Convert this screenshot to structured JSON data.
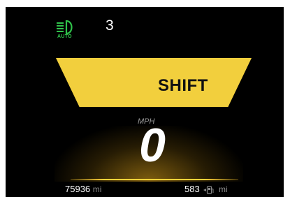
{
  "header": {
    "headlight_mode": "AUTO",
    "gear": "3"
  },
  "alert": {
    "label": "SHIFT"
  },
  "speed": {
    "unit": "MPH",
    "value": "0"
  },
  "footer": {
    "odometer_value": "75936",
    "odometer_unit": "mi",
    "range_value": "583",
    "range_unit": "mi"
  },
  "colors": {
    "headlight_green": "#2fc24a",
    "shift_yellow": "#f2cf3d",
    "accent_line": "#ffd23a"
  },
  "icons": [
    "headlight-icon",
    "fuel-pump-icon"
  ]
}
